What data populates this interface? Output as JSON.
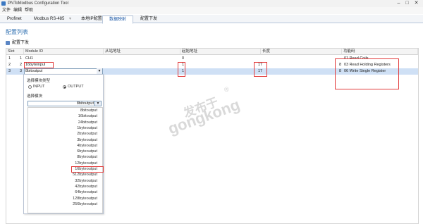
{
  "window": {
    "title": "PNToModbus Configuration Tool",
    "minimize": "–",
    "maximize": "□",
    "close": "✕"
  },
  "menu": [
    "文件",
    "编辑",
    "帮助"
  ],
  "tabs": [
    "Profinet",
    "Modbus RS-485",
    "本地IP配置",
    "数据映射",
    "配置下发"
  ],
  "active_tab": "数据映射",
  "section_title": "配置列表",
  "toolbar": {
    "download_label": "配置下发"
  },
  "grid": {
    "headers": [
      "Slot",
      "Module ID",
      "从站地址",
      "起始地址",
      "长度",
      "功能码"
    ],
    "rows": [
      {
        "num": "1",
        "slot": "1",
        "module": "CH1",
        "slave": "",
        "start": "0",
        "length": "",
        "func": "01 Read Coils"
      },
      {
        "num": "2",
        "slot": "2",
        "module": "16byteinput",
        "slave": "",
        "start": "1",
        "length": "17",
        "func_code": "8",
        "func": "03 Read Holding Registers"
      },
      {
        "num": "3",
        "slot": "3",
        "module": "8bitoutput",
        "slave": "",
        "start": "1",
        "length": "17",
        "func_code": "8",
        "func": "06 Write Single Register"
      }
    ]
  },
  "dropdown": {
    "type_label": "选择模块类型",
    "input_label": "INPUT",
    "output_label": "OUTPUT",
    "selected_type": "OUTPUT",
    "module_label": "选择模块",
    "selected_module": "8bitoutput",
    "options": [
      "8bitoutput",
      "16bitoutput",
      "24bitoutput",
      "1byteoutput",
      "2byteoutput",
      "3byteoutput",
      "4byteoutput",
      "6byteoutput",
      "8byteoutput",
      "12byteoutput",
      "16byteoutput",
      "512byteoutput",
      "32byteoutput",
      "42byteoutput",
      "64byteoutput",
      "128byteoutput",
      "256byteoutput"
    ],
    "highlighted_option": "16byteoutput"
  },
  "watermark": {
    "line1": "发布于",
    "line2": "gongkong",
    "mark": "®"
  },
  "colors": {
    "accent": "#2f6fb0",
    "highlight": "#e23b3b",
    "selected_row": "#cfe0f5"
  }
}
